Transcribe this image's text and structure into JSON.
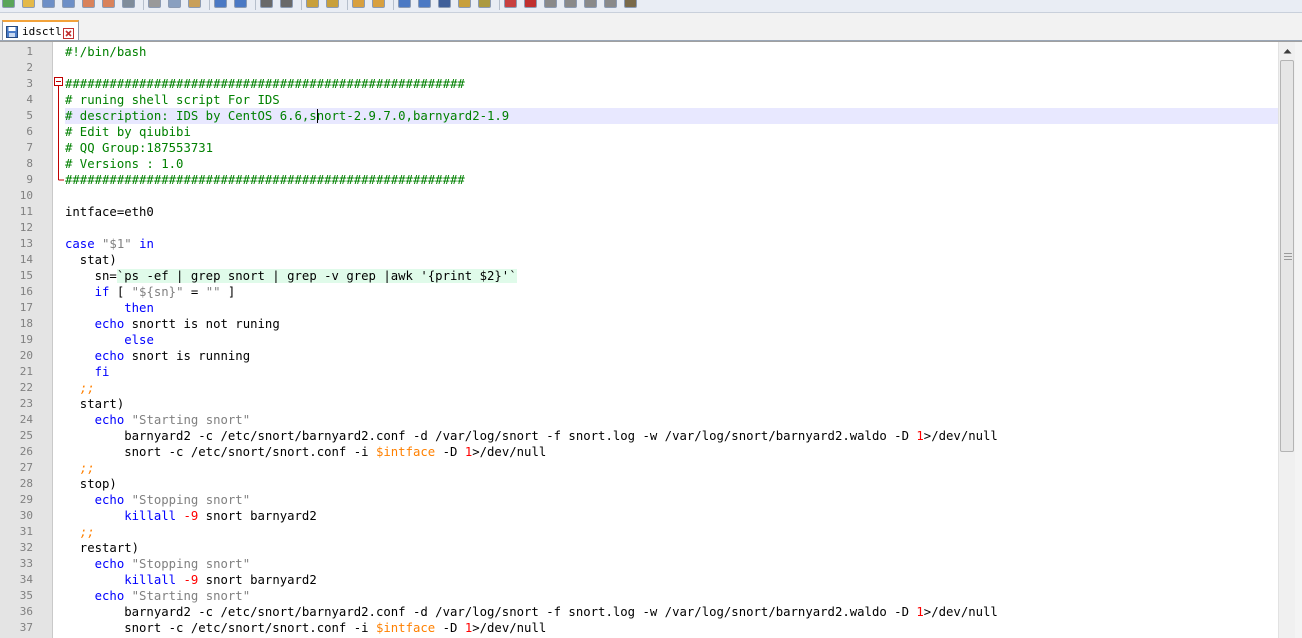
{
  "toolbar": {
    "icons": [
      "new-file-icon",
      "open-file-icon",
      "save-icon",
      "save-all-icon",
      "close-icon",
      "close-all-icon",
      "print-icon",
      "cut-icon",
      "copy-icon",
      "paste-icon",
      "undo-icon",
      "redo-icon",
      "find-icon",
      "replace-icon",
      "zoom-in-icon",
      "zoom-out-icon",
      "sync-vertical-icon",
      "sync-horizontal-icon",
      "word-wrap-icon",
      "show-all-chars-icon",
      "indent-guide-icon",
      "user-language-icon",
      "document-map-icon",
      "function-list-icon",
      "record-macro-icon",
      "stop-macro-icon",
      "play-macro-icon",
      "run-macro-icon",
      "save-macro-icon",
      "monitoring-icon"
    ]
  },
  "tab": {
    "title": "idsctl",
    "save_icon": "save-icon",
    "close_icon": "close-icon"
  },
  "colors": {
    "comment": "#008000",
    "keyword": "#0000ff",
    "string": "#808080",
    "variable": "#ff8000",
    "number": "#ff0000",
    "current_line": "#e8e8ff",
    "gutter": "#e4e4e4",
    "fold_marker": "#c00000"
  },
  "editor": {
    "current_line": 5,
    "lines": [
      "#!/bin/bash",
      "",
      "######################################################",
      "# runing shell script For IDS",
      "# description: IDS by CentOS 6.6,snort-2.9.7.0,barnyard2-1.9",
      "# Edit by qiubibi",
      "# QQ Group:187553731",
      "# Versions : 1.0",
      "######################################################",
      "",
      "intface=eth0",
      "",
      "case \"$1\" in",
      "  stat)",
      "    sn=`ps -ef | grep snort | grep -v grep |awk '{print $2}'`",
      "    if [ \"${sn}\" = \"\" ]",
      "        then",
      "    echo snortt is not runing",
      "        else",
      "    echo snort is running",
      "    fi",
      "  ;;",
      "  start)",
      "    echo \"Starting snort\"",
      "        barnyard2 -c /etc/snort/barnyard2.conf -d /var/log/snort -f snort.log -w /var/log/snort/barnyard2.waldo -D 1>/dev/null",
      "        snort -c /etc/snort/snort.conf -i $intface -D 1>/dev/null",
      "  ;;",
      "  stop)",
      "    echo \"Stopping snort\"",
      "        killall -9 snort barnyard2",
      "  ;;",
      "  restart)",
      "    echo \"Stopping snort\"",
      "        killall -9 snort barnyard2",
      "    echo \"Starting snort\"",
      "        barnyard2 -c /etc/snort/barnyard2.conf -d /var/log/snort -f snort.log -w /var/log/snort/barnyard2.waldo -D 1>/dev/null",
      "        snort -c /etc/snort/snort.conf -i $intface -D 1>/dev/null"
    ]
  }
}
